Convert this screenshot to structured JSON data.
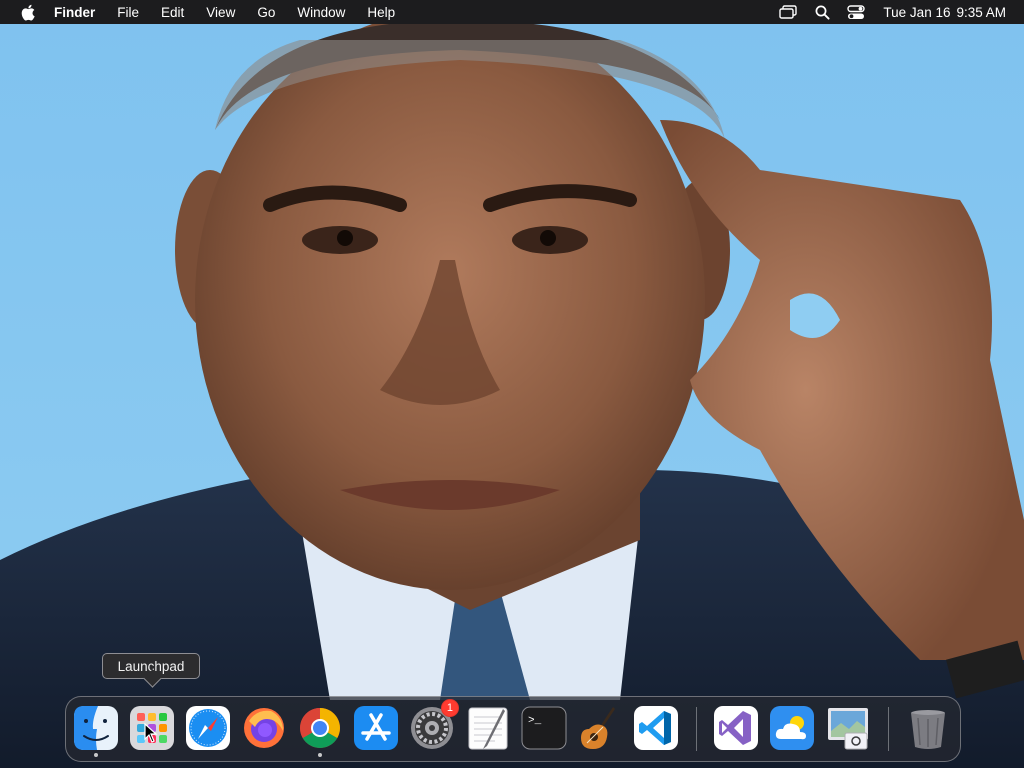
{
  "menubar": {
    "apple_icon": "apple-logo-icon",
    "app_name": "Finder",
    "menus": [
      "File",
      "Edit",
      "View",
      "Go",
      "Window",
      "Help"
    ],
    "status_icons": [
      "screen-mirroring-icon",
      "spotlight-search-icon",
      "control-center-icon"
    ],
    "date": "Tue Jan 16",
    "time": "9:35 AM"
  },
  "tooltip": {
    "text": "Launchpad"
  },
  "dock": {
    "apps": [
      {
        "name": "Finder",
        "icon": "finder-icon",
        "running": true
      },
      {
        "name": "Launchpad",
        "icon": "launchpad-icon",
        "running": false
      },
      {
        "name": "Safari",
        "icon": "safari-icon",
        "running": false
      },
      {
        "name": "Firefox",
        "icon": "firefox-icon",
        "running": false
      },
      {
        "name": "Google Chrome",
        "icon": "chrome-icon",
        "running": true
      },
      {
        "name": "App Store",
        "icon": "app-store-icon",
        "running": false
      },
      {
        "name": "System Settings",
        "icon": "system-settings-icon",
        "running": false,
        "badge": "1"
      },
      {
        "name": "TextEdit",
        "icon": "textedit-icon",
        "running": false
      },
      {
        "name": "Terminal",
        "icon": "terminal-icon",
        "running": false
      },
      {
        "name": "GarageBand",
        "icon": "garageband-icon",
        "running": false
      },
      {
        "name": "Visual Studio Code",
        "icon": "vscode-icon",
        "running": false
      }
    ],
    "recent_apps": [
      {
        "name": "Visual Studio",
        "icon": "visual-studio-icon"
      },
      {
        "name": "Weather",
        "icon": "weather-icon"
      },
      {
        "name": "Preview",
        "icon": "preview-icon"
      }
    ],
    "trash": {
      "name": "Trash",
      "icon": "trash-icon"
    }
  },
  "colors": {
    "menubar_bg": "#1c1c1e",
    "wallpaper_sky": "#82c3ee",
    "badge_red": "#ff3b30"
  }
}
